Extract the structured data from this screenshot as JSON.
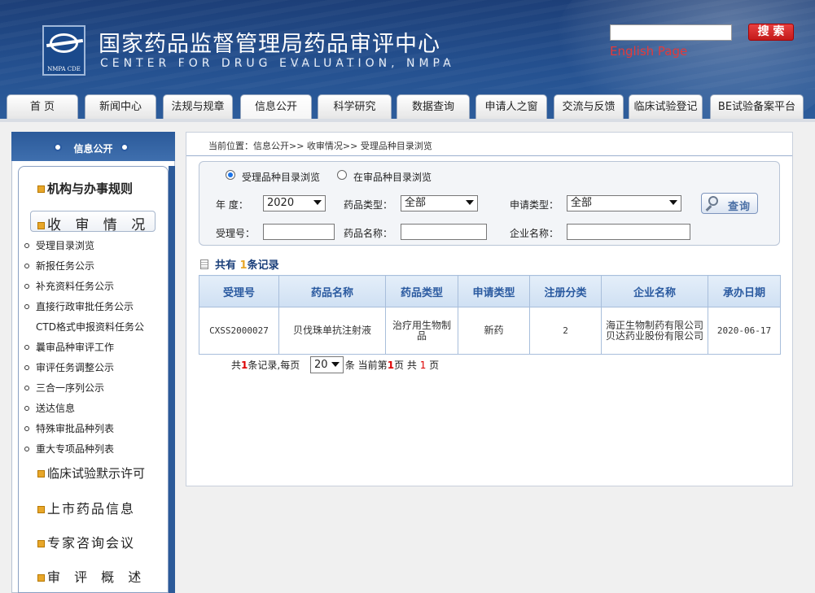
{
  "header": {
    "title_cn": "国家药品监督管理局药品审评中心",
    "title_en": "CENTER FOR DRUG EVALUATION, NMPA",
    "logo_caption": "NMPA CDE",
    "search_button": "搜 索",
    "english_link": "English Page"
  },
  "nav": {
    "tabs": [
      {
        "label": "首  页"
      },
      {
        "label": "新闻中心"
      },
      {
        "label": "法规与规章"
      },
      {
        "label": "信息公开"
      },
      {
        "label": "科学研究"
      },
      {
        "label": "数据查询"
      },
      {
        "label": "申请人之窗"
      },
      {
        "label": "交流与反馈"
      },
      {
        "label": "临床试验登记"
      },
      {
        "label": "BE试验备案平台"
      }
    ],
    "active": "信息公开"
  },
  "sidebar": {
    "header": "信息公开",
    "sections": [
      {
        "title": "机构与办事规则"
      },
      {
        "title": "收 审 情 况"
      },
      {
        "title": "临床试验默示许可"
      },
      {
        "title": "上市药品信息"
      },
      {
        "title": "专家咨询会议"
      },
      {
        "title": "审 评 概 述"
      }
    ],
    "items": [
      {
        "label": "受理目录浏览"
      },
      {
        "label": "新报任务公示"
      },
      {
        "label": "补充资料任务公示"
      },
      {
        "label": "直接行政审批任务公示"
      },
      {
        "label": "CTD格式申报资料任务公"
      },
      {
        "label": "曩审品种审评工作"
      },
      {
        "label": "审评任务调整公示"
      },
      {
        "label": "三合一序列公示"
      },
      {
        "label": "送达信息"
      },
      {
        "label": "特殊审批品种列表"
      },
      {
        "label": "重大专项品种列表"
      }
    ]
  },
  "breadcrumb": "当前位置：信息公开>> 收审情况>> 受理品种目录浏览",
  "filters": {
    "radio1": "受理品种目录浏览",
    "radio2": "在审品种目录浏览",
    "year_label": "年  度：",
    "year_value": "2020",
    "drug_type_label": "药品类型：",
    "drug_type_value": "全部",
    "apply_type_label": "申请类型：",
    "apply_type_value": "全部",
    "accept_no_label": "受理号：",
    "drug_name_label": "药品名称：",
    "company_label": "企业名称：",
    "accept_no_value": "",
    "drug_name_value": "",
    "company_value": "",
    "query_button": "查询"
  },
  "records": {
    "prefix": "共有",
    "count": "1",
    "suffix": "条记录"
  },
  "table": {
    "headers": [
      "受理号",
      "药品名称",
      "药品类型",
      "申请类型",
      "注册分类",
      "企业名称",
      "承办日期"
    ],
    "rows": [
      [
        "CXSS2000027",
        "贝伐珠单抗注射液",
        "治疗用生物制品",
        "新药",
        "2",
        "海正生物制药有限公司 贝达药业股份有限公司",
        "2020-06-17"
      ]
    ]
  },
  "pager": {
    "t1": "共",
    "total": "1",
    "t2": "条记录,每页",
    "page_size": "20",
    "t3": "条 当前第",
    "current": "1",
    "t4": "页 共",
    "pages": "1",
    "t5": "页"
  }
}
